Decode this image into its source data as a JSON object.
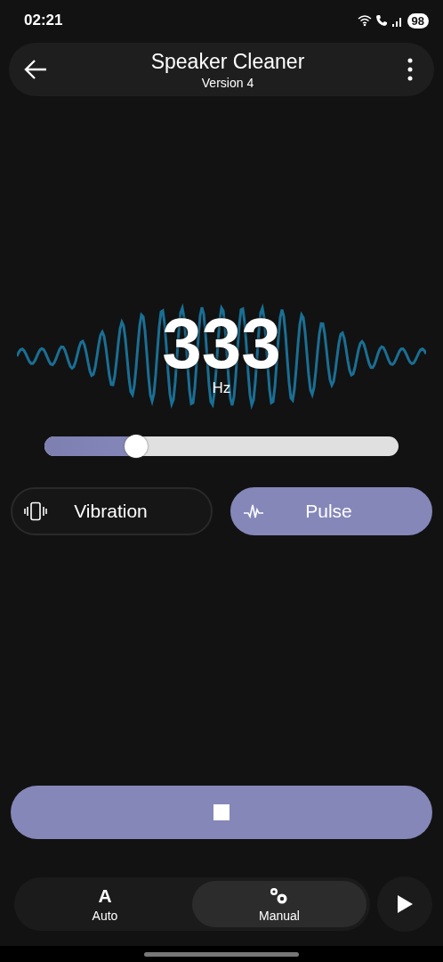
{
  "status_bar": {
    "time": "02:21",
    "battery": "98"
  },
  "header": {
    "title": "Speaker Cleaner",
    "subtitle": "Version 4"
  },
  "frequency": {
    "value": "333",
    "unit": "Hz"
  },
  "slider": {
    "level": 0.26
  },
  "modes": [
    {
      "label": "Vibration",
      "kind": "vibration",
      "selected": false
    },
    {
      "label": "Pulse",
      "kind": "pulse",
      "selected": true
    }
  ],
  "stop_button": {
    "active": true
  },
  "bottom_tabs": [
    {
      "label": "Auto",
      "kind": "auto",
      "icon_text": "A",
      "selected": false
    },
    {
      "label": "Manual",
      "kind": "manual",
      "selected": true
    }
  ]
}
